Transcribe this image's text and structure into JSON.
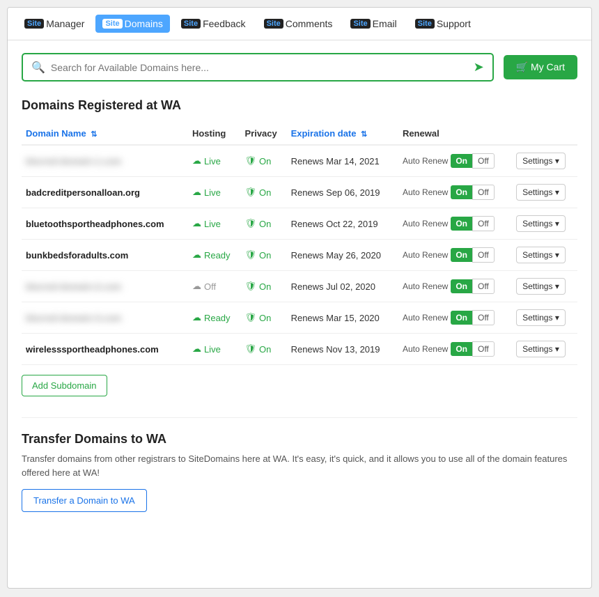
{
  "nav": {
    "items": [
      {
        "id": "manager",
        "label": "Manager",
        "active": false
      },
      {
        "id": "domains",
        "label": "Domains",
        "active": true
      },
      {
        "id": "feedback",
        "label": "Feedback",
        "active": false
      },
      {
        "id": "comments",
        "label": "Comments",
        "active": false
      },
      {
        "id": "email",
        "label": "Email",
        "active": false
      },
      {
        "id": "support",
        "label": "Support",
        "active": false
      }
    ]
  },
  "search": {
    "placeholder": "Search for Available Domains here...",
    "value": ""
  },
  "cart": {
    "label": "🛒 My Cart"
  },
  "domains_section": {
    "title": "Domains Registered at WA",
    "columns": {
      "domain_name": "Domain Name",
      "hosting": "Hosting",
      "privacy": "Privacy",
      "expiration": "Expiration date",
      "renewal": "Renewal"
    },
    "rows": [
      {
        "domain": "blurred-domain-1.com",
        "blurred": true,
        "hosting_status": "Live",
        "hosting_type": "live",
        "privacy_status": "On",
        "expiration": "Renews Mar 14, 2021",
        "renewal": "Auto Renew",
        "toggle_on": "On",
        "toggle_off": "Off",
        "settings_label": "Settings ▾"
      },
      {
        "domain": "badcreditpersonalloan.org",
        "blurred": false,
        "hosting_status": "Live",
        "hosting_type": "live",
        "privacy_status": "On",
        "expiration": "Renews Sep 06, 2019",
        "renewal": "Auto Renew",
        "toggle_on": "On",
        "toggle_off": "Off",
        "settings_label": "Settings ▾"
      },
      {
        "domain": "bluetoothsportheadphones.com",
        "blurred": false,
        "hosting_status": "Live",
        "hosting_type": "live",
        "privacy_status": "On",
        "expiration": "Renews Oct 22, 2019",
        "renewal": "Auto Renew",
        "toggle_on": "On",
        "toggle_off": "Off",
        "settings_label": "Settings ▾"
      },
      {
        "domain": "bunkbedsforadults.com",
        "blurred": false,
        "hosting_status": "Ready",
        "hosting_type": "ready",
        "privacy_status": "On",
        "expiration": "Renews May 26, 2020",
        "renewal": "Auto Renew",
        "toggle_on": "On",
        "toggle_off": "Off",
        "settings_label": "Settings ▾"
      },
      {
        "domain": "blurred-domain-2.com",
        "blurred": true,
        "hosting_status": "Off",
        "hosting_type": "off",
        "privacy_status": "On",
        "expiration": "Renews Jul 02, 2020",
        "renewal": "Auto Renew",
        "toggle_on": "On",
        "toggle_off": "Off",
        "settings_label": "Settings ▾"
      },
      {
        "domain": "blurred-domain-3.com",
        "blurred": true,
        "hosting_status": "Ready",
        "hosting_type": "ready",
        "privacy_status": "On",
        "expiration": "Renews Mar 15, 2020",
        "renewal": "Auto Renew",
        "toggle_on": "On",
        "toggle_off": "Off",
        "settings_label": "Settings ▾"
      },
      {
        "domain": "wirelesssportheadphones.com",
        "blurred": false,
        "hosting_status": "Live",
        "hosting_type": "live",
        "privacy_status": "On",
        "expiration": "Renews Nov 13, 2019",
        "renewal": "Auto Renew",
        "toggle_on": "On",
        "toggle_off": "Off",
        "settings_label": "Settings ▾"
      }
    ],
    "add_subdomain_label": "Add Subdomain"
  },
  "transfer_section": {
    "title": "Transfer Domains to WA",
    "description": "Transfer domains from other registrars to SiteDomains here at WA. It's easy, it's quick, and it allows you to use all of the domain features offered here at WA!",
    "button_label": "Transfer a Domain to WA"
  }
}
